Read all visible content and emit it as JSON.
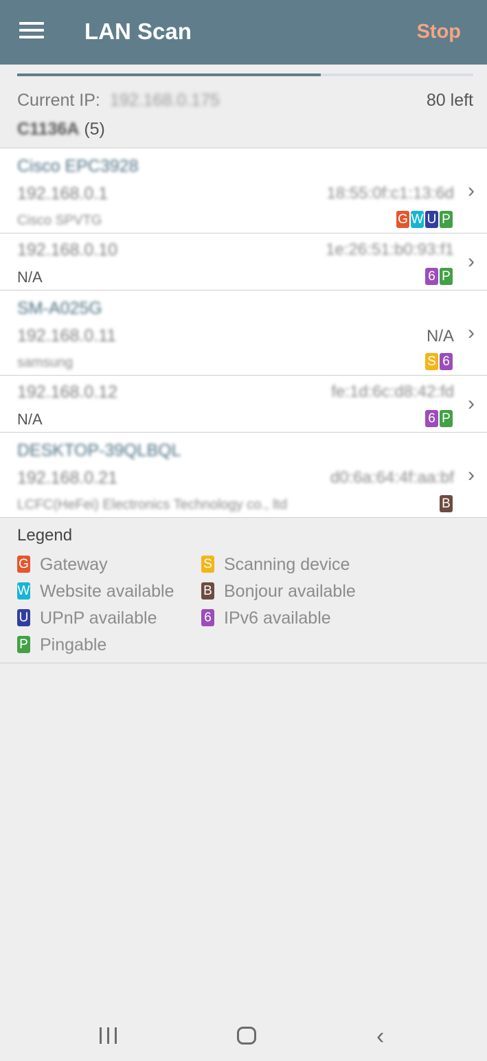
{
  "app_bar": {
    "title": "LAN Scan",
    "stop_label": "Stop"
  },
  "scan": {
    "progress_fraction": 0.666,
    "current_ip_label": "Current IP:",
    "current_ip": "192.168.0.175",
    "left_text": "80 left",
    "network_name": "C1136A",
    "network_count": "(5)"
  },
  "devices": [
    {
      "name": "Cisco EPC3928",
      "ip": "192.168.0.1",
      "vendor": "Cisco SPVTG",
      "mac": "18:55:0f:c1:13:6d",
      "badges": [
        "G",
        "W",
        "U",
        "P"
      ]
    },
    {
      "name": "",
      "ip": "192.168.0.10",
      "vendor": "N/A",
      "mac": "1e:26:51:b0:93:f1",
      "badges": [
        "6",
        "P"
      ]
    },
    {
      "name": "SM-A025G",
      "ip": "192.168.0.11",
      "vendor": "samsung",
      "mac": "N/A",
      "badges": [
        "S",
        "6"
      ]
    },
    {
      "name": "",
      "ip": "192.168.0.12",
      "vendor": "N/A",
      "mac": "fe:1d:6c:d8:42:fd",
      "badges": [
        "6",
        "P"
      ]
    },
    {
      "name": "DESKTOP-39QLBQL",
      "ip": "192.168.0.21",
      "vendor": "LCFC(HeFei) Electronics Technology co., ltd",
      "mac": "d0:6a:64:4f:aa:bf",
      "badges": [
        "B"
      ]
    }
  ],
  "legend": {
    "title": "Legend",
    "items": [
      {
        "badge": "G",
        "label": "Gateway",
        "color": "#e4572e"
      },
      {
        "badge": "W",
        "label": "Website available",
        "color": "#17b5d3"
      },
      {
        "badge": "U",
        "label": "UPnP available",
        "color": "#303f9f"
      },
      {
        "badge": "P",
        "label": "Pingable",
        "color": "#43a047"
      },
      {
        "badge": "S",
        "label": "Scanning device",
        "color": "#f2b618"
      },
      {
        "badge": "B",
        "label": "Bonjour available",
        "color": "#6d4c41"
      },
      {
        "badge": "6",
        "label": "IPv6 available",
        "color": "#9c4dba"
      }
    ]
  },
  "colors": {
    "app_bar": "#607d8b",
    "stop": "#f4a582",
    "badge_G": "#e4572e",
    "badge_W": "#17b5d3",
    "badge_U": "#303f9f",
    "badge_P": "#43a047",
    "badge_S": "#f2b618",
    "badge_B": "#6d4c41",
    "badge_6": "#9c4dba"
  },
  "icons": {
    "menu": "hamburger-menu-icon",
    "chevron": "chevron-right-icon",
    "nav_recent": "recent-apps-icon",
    "nav_home": "home-icon",
    "nav_back": "back-icon"
  }
}
